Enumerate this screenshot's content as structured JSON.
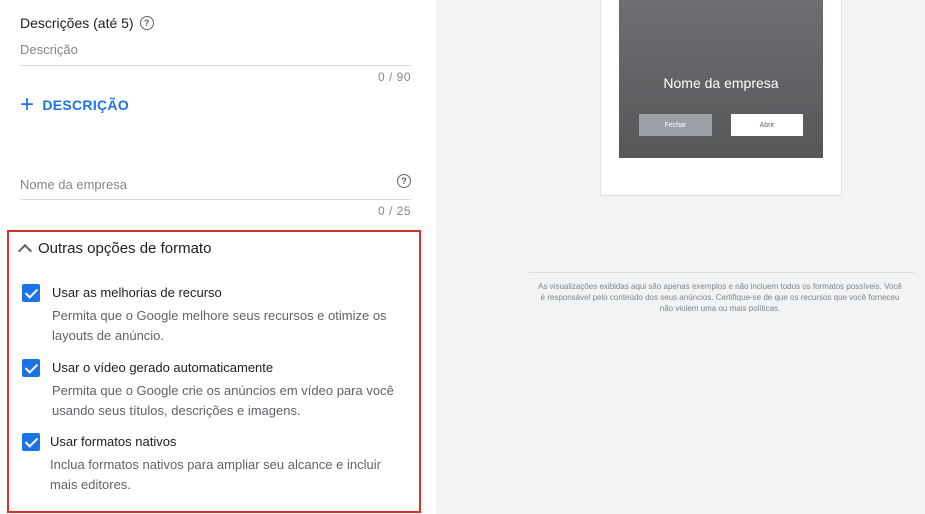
{
  "descriptions": {
    "title": "Descrições (até 5)",
    "help_icon": "?",
    "placeholder": "Descrição",
    "counter": "0 / 90",
    "add_label": "DESCRIÇÃO",
    "add_icon": "+"
  },
  "business": {
    "placeholder": "Nome da empresa",
    "help_icon": "?",
    "counter": "0 / 25"
  },
  "format_options": {
    "header": "Outras opções de formato",
    "items": [
      {
        "title": "Usar as melhorias de recurso",
        "desc": "Permita que o Google melhore seus recursos e otimize os layouts de anúncio.",
        "checked": true
      },
      {
        "title": "Usar o vídeo gerado automaticamente",
        "desc": "Permita que o Google crie os anúncios em vídeo para você usando seus títulos, descrições e imagens.",
        "checked": true
      },
      {
        "title": "Usar formatos nativos",
        "desc": "Inclua formatos nativos para ampliar seu alcance e incluir mais editores.",
        "checked": true
      }
    ]
  },
  "preview": {
    "company_name": "Nome da empresa",
    "close_label": "Fechar",
    "open_label": "Abrir",
    "disclaimer": "As visualizações exibidas aqui são apenas exemplos e não incluem todos os formatos possíveis. Você é responsável pelo conteúdo dos seus anúncios. Certifique-se de que os recursos que você forneceu não violem uma ou mais políticas."
  },
  "colors": {
    "accent": "#1a73e8",
    "highlight_border": "#d93025",
    "preview_bg": "#f1f3f4"
  }
}
